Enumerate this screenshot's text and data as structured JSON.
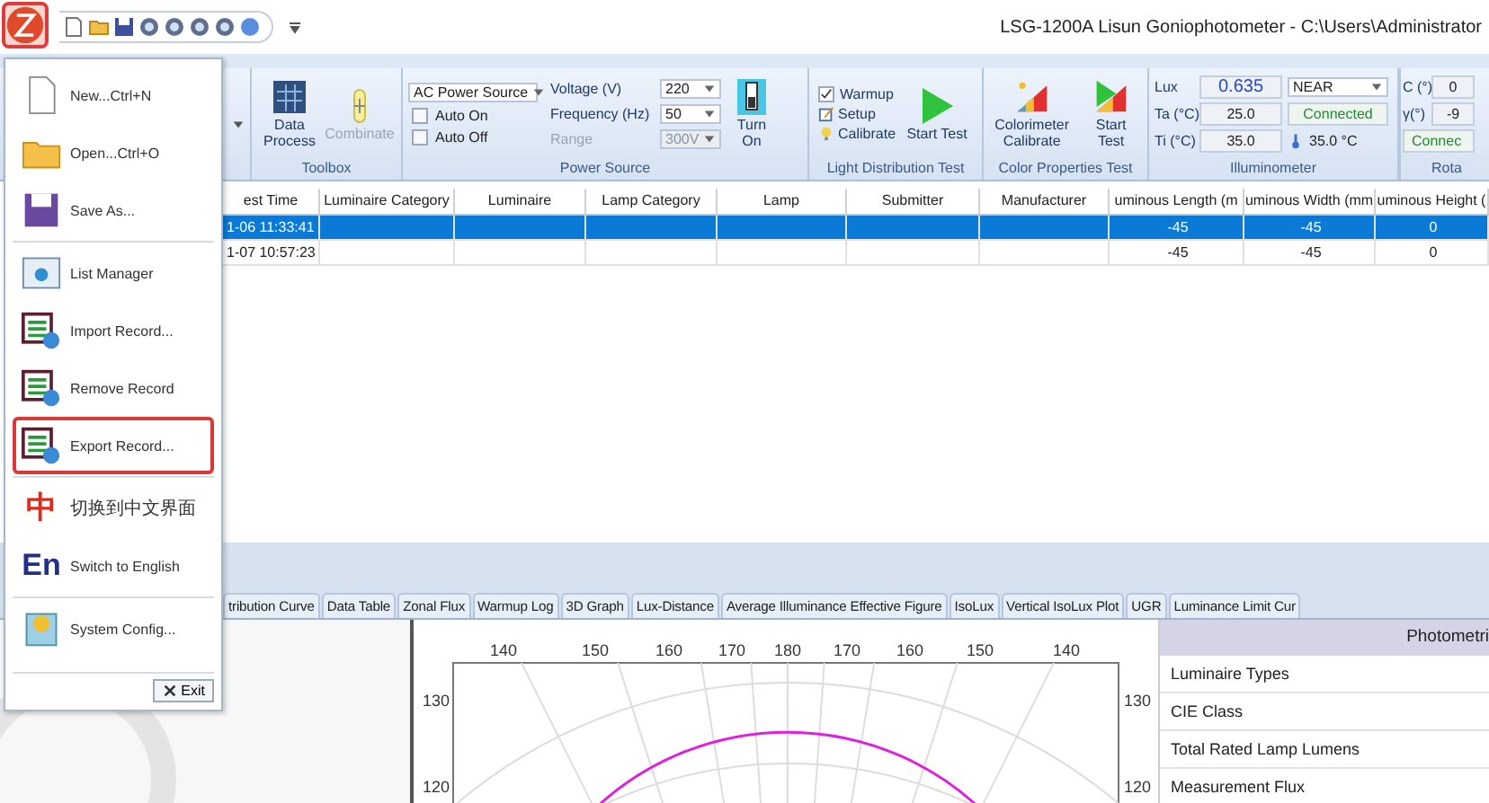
{
  "app": {
    "title": "LSG-1200A Lisun Goniophotometer  - C:\\Users\\Administrator"
  },
  "menu": {
    "groups": [
      [
        {
          "label": "New...Ctrl+N",
          "selected": false
        },
        {
          "label": "Open...Ctrl+O",
          "selected": false
        },
        {
          "label": "Save As...",
          "selected": false
        }
      ],
      [
        {
          "label": "List Manager",
          "selected": false
        },
        {
          "label": "Import Record...",
          "selected": false
        },
        {
          "label": "Remove Record",
          "selected": false
        },
        {
          "label": "Export Record...",
          "selected": true
        }
      ],
      [
        {
          "label": "切换到中文界面",
          "glyph": "中",
          "selected": false
        },
        {
          "label": "Switch to English",
          "glyph": "En",
          "selected": false
        }
      ],
      [
        {
          "label": "System Config...",
          "selected": false
        }
      ]
    ],
    "exit": "Exit"
  },
  "ribbon": {
    "groups": [
      {
        "kind": "toolbox",
        "label": "Toolbox",
        "buttons": [
          {
            "label": "Data Process",
            "disabled": false
          },
          {
            "label": "Combinate",
            "disabled": true
          }
        ]
      },
      {
        "kind": "power",
        "label": "Power Source",
        "source": "AC Power Source",
        "checks": [
          {
            "label": "Auto On",
            "checked": false
          },
          {
            "label": "Auto Off",
            "checked": false
          }
        ],
        "fields": [
          {
            "label": "Voltage (V)",
            "value": "220",
            "disabled": false
          },
          {
            "label": "Frequency (Hz)",
            "value": "50",
            "disabled": false
          },
          {
            "label": "Range",
            "value": "300V",
            "disabled": true
          }
        ],
        "switch": "Turn On"
      },
      {
        "kind": "light",
        "label": "Light Distribution Test",
        "check": {
          "label": "Warmup",
          "checked": true
        },
        "actions": [
          "Setup",
          "Calibrate"
        ],
        "start": "Start Test"
      },
      {
        "kind": "color",
        "label": "Color Properties Test",
        "calibrate": "Colorimeter Calibrate",
        "start": "Start Test"
      },
      {
        "kind": "illum",
        "label": "Illuminometer",
        "readings": [
          {
            "label": "Lux",
            "value": "0.635"
          },
          {
            "label": "Ta (°C)",
            "value": "25.0"
          },
          {
            "label": "Ti (°C)",
            "value": "35.0"
          }
        ],
        "mode": "NEAR",
        "status": "Connected",
        "temperature": "35.0 °C"
      },
      {
        "kind": "rotation",
        "label": "Rota",
        "readings": [
          {
            "label": "C (°)",
            "value": "0"
          },
          {
            "label": "γ(°)",
            "value": "-9"
          }
        ],
        "status": "Connec"
      }
    ]
  },
  "table": {
    "columns": [
      "est Time",
      "Luminaire Category",
      "Luminaire",
      "Lamp Category",
      "Lamp",
      "Submitter",
      "Manufacturer",
      "uminous Length (m",
      "uminous Width (mm",
      "uminous Height ("
    ],
    "rows": [
      {
        "selected": true,
        "cells": [
          "1-06 11:33:41",
          "",
          "",
          "",
          "",
          "",
          "",
          "-45",
          "-45",
          "0"
        ]
      },
      {
        "selected": false,
        "cells": [
          "1-07 10:57:23",
          "",
          "",
          "",
          "",
          "",
          "",
          "-45",
          "-45",
          "0"
        ]
      }
    ]
  },
  "tabs": [
    {
      "label": "tribution Curve",
      "selected": false
    },
    {
      "label": "Data Table",
      "selected": false
    },
    {
      "label": "Zonal Flux",
      "selected": false
    },
    {
      "label": "Warmup Log",
      "selected": false
    },
    {
      "label": "3D Graph",
      "selected": false
    },
    {
      "label": "Lux-Distance",
      "selected": false
    },
    {
      "label": "Average Illuminance Effective Figure",
      "selected": false
    },
    {
      "label": "IsoLux",
      "selected": false
    },
    {
      "label": "Vertical IsoLux Plot",
      "selected": false
    },
    {
      "label": "UGR",
      "selected": false
    },
    {
      "label": "Luminance Limit Cur",
      "selected": false
    }
  ],
  "polar": {
    "top_labels": [
      "140",
      "150",
      "160",
      "170",
      "180",
      "170",
      "160",
      "150",
      "140"
    ],
    "left_labels": [
      "130",
      "120"
    ],
    "right_labels": [
      "130",
      "120"
    ]
  },
  "photometric": {
    "title": "Photometri",
    "rows": [
      "Luminaire Types",
      "CIE Class",
      "Total Rated Lamp Lumens",
      "Measurement Flux"
    ]
  }
}
